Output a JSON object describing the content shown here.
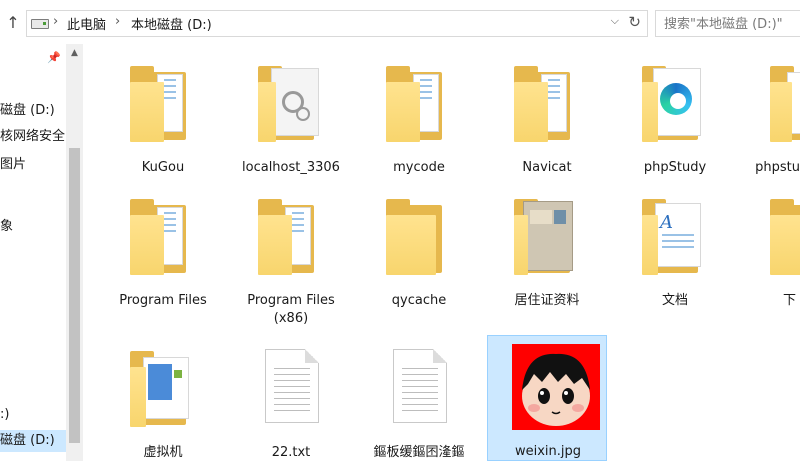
{
  "address": {
    "path": [
      "此电脑",
      "本地磁盘 (D:)"
    ],
    "search_placeholder": "搜索\"本地磁盘 (D:)\""
  },
  "icons": {
    "up": "up-arrow-icon",
    "drive": "drive-icon",
    "dropdown": "chevron-down-icon",
    "refresh": "refresh-icon",
    "pin": "pin-icon"
  },
  "nav": {
    "items": [
      {
        "label": "磁盘 (D:)"
      },
      {
        "label": "核网络安全("
      },
      {
        "label": "图片"
      },
      {
        "label": "象"
      },
      {
        "label": ":)"
      },
      {
        "label": "磁盘 (D:)"
      }
    ]
  },
  "files": [
    {
      "name": "KuGou",
      "type": "folder"
    },
    {
      "name": "localhost_3306",
      "type": "folder-gear"
    },
    {
      "name": "mycode",
      "type": "folder"
    },
    {
      "name": "Navicat",
      "type": "folder"
    },
    {
      "name": "phpStudy",
      "type": "folder-edge"
    },
    {
      "name": "phpstu",
      "type": "folder"
    },
    {
      "name": "Program Files",
      "type": "folder"
    },
    {
      "name": "Program Files",
      "name2": "(x86)",
      "type": "folder"
    },
    {
      "name": "qycache",
      "type": "folder-empty"
    },
    {
      "name": "居住证资料",
      "type": "folder-doc"
    },
    {
      "name": "文档",
      "type": "folder-word"
    },
    {
      "name": "下",
      "type": "folder"
    },
    {
      "name": "虚拟机",
      "type": "folder"
    },
    {
      "name": "22.txt",
      "type": "txt"
    },
    {
      "name": "鏂板缓鏂囨湰鏂",
      "type": "txt"
    },
    {
      "name": "weixin.jpg",
      "type": "image"
    }
  ],
  "colors": {
    "selection": "#cce8ff",
    "folder": "#f8d56d",
    "image_bg": "#ff0000"
  }
}
